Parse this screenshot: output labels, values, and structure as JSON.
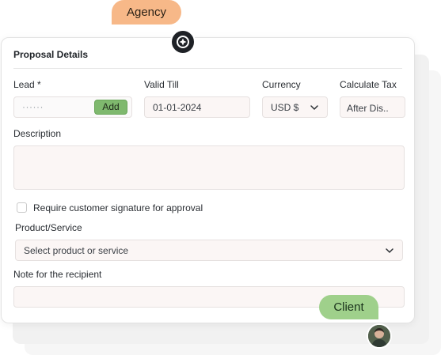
{
  "badges": {
    "agency": "Agency",
    "client": "Client"
  },
  "card": {
    "title": "Proposal Details"
  },
  "lead": {
    "label": "Lead *",
    "value": "······",
    "add_button": "Add"
  },
  "valid_till": {
    "label": "Valid Till",
    "value": "01-01-2024"
  },
  "currency": {
    "label": "Currency",
    "value": "USD $"
  },
  "calculate_tax": {
    "label": "Calculate Tax",
    "value": "After Dis.."
  },
  "description": {
    "label": "Description",
    "value": ""
  },
  "signature": {
    "label": "Require customer signature for approval",
    "checked": false
  },
  "product_service": {
    "label": "Product/Service",
    "placeholder": "Select product or service"
  },
  "note": {
    "label": "Note for the recipient",
    "value": ""
  },
  "colors": {
    "agency_badge": "#f7b888",
    "client_badge": "#9fd08b",
    "add_button": "#7fb96e",
    "field_bg": "#fbf6f5"
  },
  "icons": {
    "agency": "agency-logo-icon",
    "client": "client-avatar",
    "currency_dropdown": "chevron-down-icon",
    "product_dropdown": "chevron-down-icon"
  }
}
